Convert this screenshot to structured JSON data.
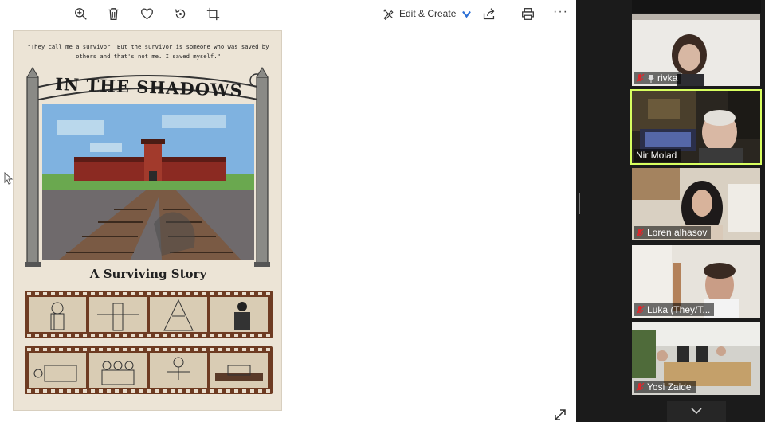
{
  "toolbar": {
    "zoom_icon": "zoom-in-icon",
    "delete_icon": "trash-icon",
    "favorite_icon": "heart-icon",
    "rotate_icon": "rotate-icon",
    "crop_icon": "crop-icon",
    "edit_create_label": "Edit & Create",
    "share_icon": "share-icon",
    "print_icon": "print-icon",
    "more_label": "···"
  },
  "poster": {
    "quote": "\"They call me a survivor. But the survivor is someone who was saved by others and that's not me. I saved myself.\"",
    "title": "IN THE SHADOWS",
    "subtitle": "A Surviving Story"
  },
  "participants": [
    {
      "name": "rivka",
      "muted": true,
      "pinned": true,
      "active": false
    },
    {
      "name": "Nir Molad",
      "muted": false,
      "pinned": false,
      "active": true
    },
    {
      "name": "Loren alhasov",
      "muted": true,
      "pinned": false,
      "active": false
    },
    {
      "name": "Luka (They/T...",
      "muted": true,
      "pinned": false,
      "active": false
    },
    {
      "name": "Yosi Zaide",
      "muted": true,
      "pinned": false,
      "active": false
    }
  ],
  "colors": {
    "active_speaker": "#d8ff5f",
    "muted_red": "#e0262b",
    "film_strip": "#6e3b22",
    "poster_bg": "#ece4d6"
  }
}
